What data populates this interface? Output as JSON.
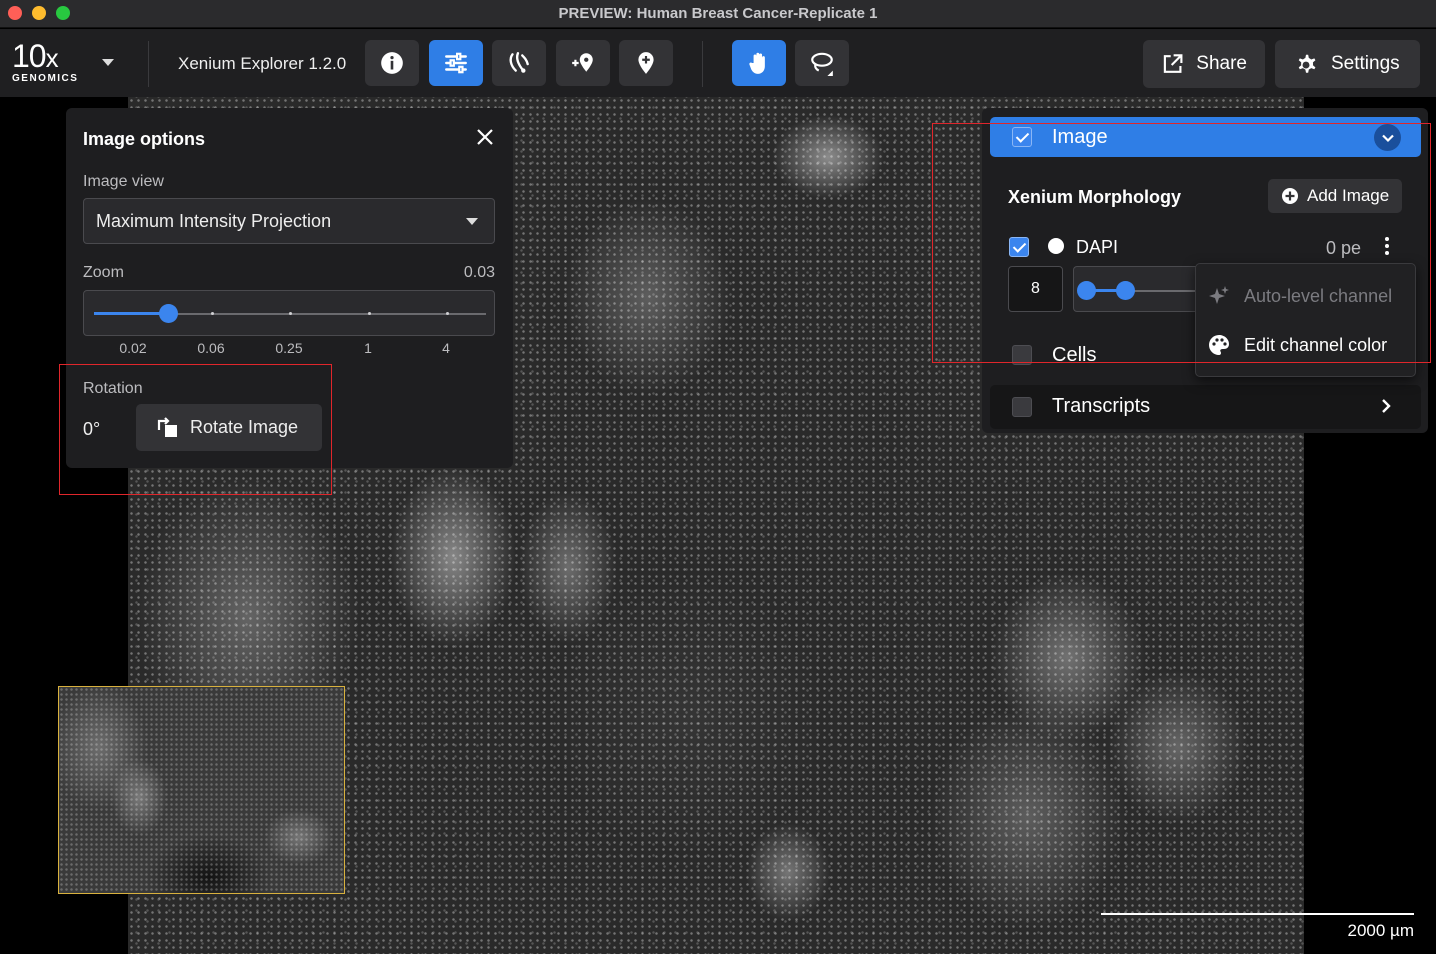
{
  "window": {
    "title": "PREVIEW: Human Breast Cancer-Replicate 1"
  },
  "toolbar": {
    "logo_main": "10",
    "logo_x": "x",
    "logo_sub": "GENOMICS",
    "app_name": "Xenium Explorer 1.2.0",
    "tools": [
      {
        "name": "info-icon",
        "active": false
      },
      {
        "name": "sliders-icon",
        "active": true
      },
      {
        "name": "cell-lineage-icon",
        "active": false
      },
      {
        "name": "add-location-icon",
        "active": false
      },
      {
        "name": "location-pin-icon",
        "active": false
      },
      {
        "name": "hand-pan-icon",
        "active": true
      },
      {
        "name": "lasso-icon",
        "active": false
      }
    ],
    "share_label": "Share",
    "settings_label": "Settings"
  },
  "image_options": {
    "title": "Image options",
    "image_view_label": "Image view",
    "image_view_value": "Maximum Intensity Projection",
    "zoom_label": "Zoom",
    "zoom_value": "0.03",
    "zoom_ticks": [
      "0.02",
      "0.06",
      "0.25",
      "1",
      "4"
    ],
    "zoom_position_fraction": 0.19,
    "rotation_label": "Rotation",
    "rotation_value": "0°",
    "rotate_button_label": "Rotate Image"
  },
  "layers": {
    "image_layer": {
      "label": "Image",
      "checked": true
    },
    "section_title": "Xenium Morphology",
    "add_image_label": "Add Image",
    "channel": {
      "label": "DAPI",
      "checked": true,
      "value_text": "0 pe",
      "min_input": "8",
      "color": "#ffffff"
    },
    "cells_layer": {
      "label": "Cells",
      "checked": false
    },
    "transcripts_layer": {
      "label": "Transcripts",
      "checked": false
    }
  },
  "context_menu": {
    "items": [
      {
        "label": "Auto-level channel",
        "icon": "sparkle-icon",
        "disabled": true
      },
      {
        "label": "Edit channel color",
        "icon": "palette-icon",
        "disabled": false
      }
    ]
  },
  "scale_bar": {
    "label": "2000  µm"
  },
  "colors": {
    "accent": "#2f7ee6",
    "highlight": "#e0262b",
    "minimap_border": "#d8b13e"
  }
}
